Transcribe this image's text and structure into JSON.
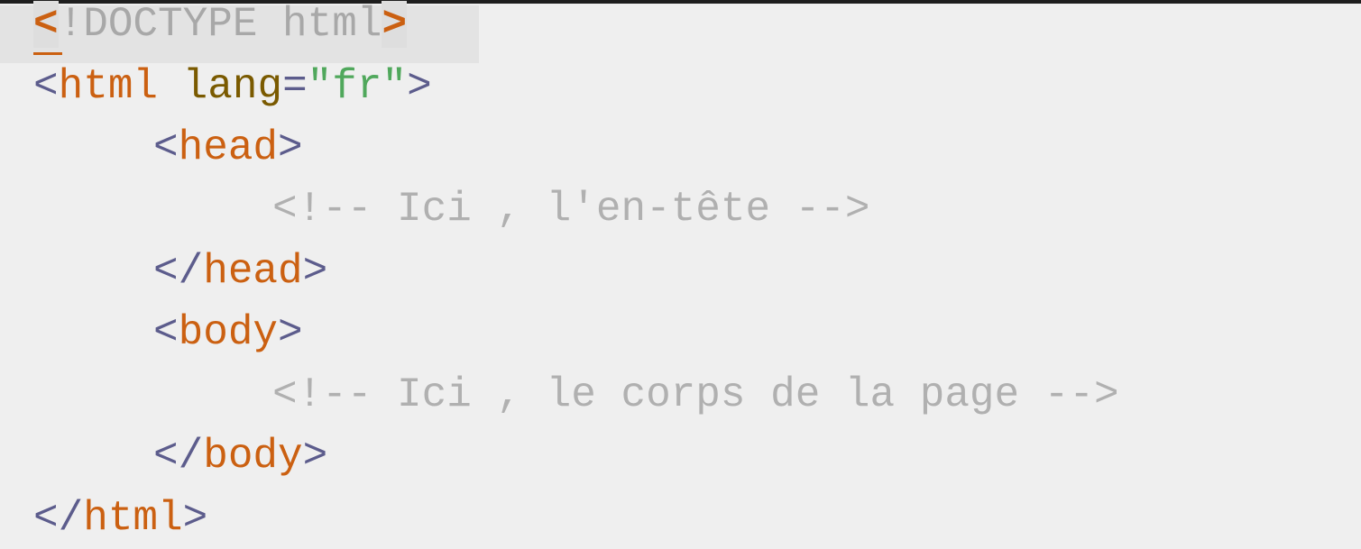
{
  "code": {
    "line1": {
      "open": "<",
      "text": "!DOCTYPE html",
      "close": ">"
    },
    "line2": {
      "open": "<",
      "tag": "html",
      "attr": "lang",
      "eq": "=",
      "value": "\"fr\"",
      "close": ">"
    },
    "line3": {
      "open": "<",
      "tag": "head",
      "close": ">"
    },
    "line4": {
      "comment": "<!-- Ici , l'en-tête -->"
    },
    "line5": {
      "open": "</",
      "tag": "head",
      "close": ">"
    },
    "line6": {
      "open": "<",
      "tag": "body",
      "close": ">"
    },
    "line7": {
      "comment": "<!-- Ici , le corps de la page -->"
    },
    "line8": {
      "open": "</",
      "tag": "body",
      "close": ">"
    },
    "line9": {
      "open": "</",
      "tag": "html",
      "close": ">"
    }
  },
  "colors": {
    "background": "#efefef",
    "tag": "#cb6011",
    "bracket": "#5c5c8c",
    "attribute": "#7a5a00",
    "string": "#50a85c",
    "comment": "#b0b0b0"
  }
}
